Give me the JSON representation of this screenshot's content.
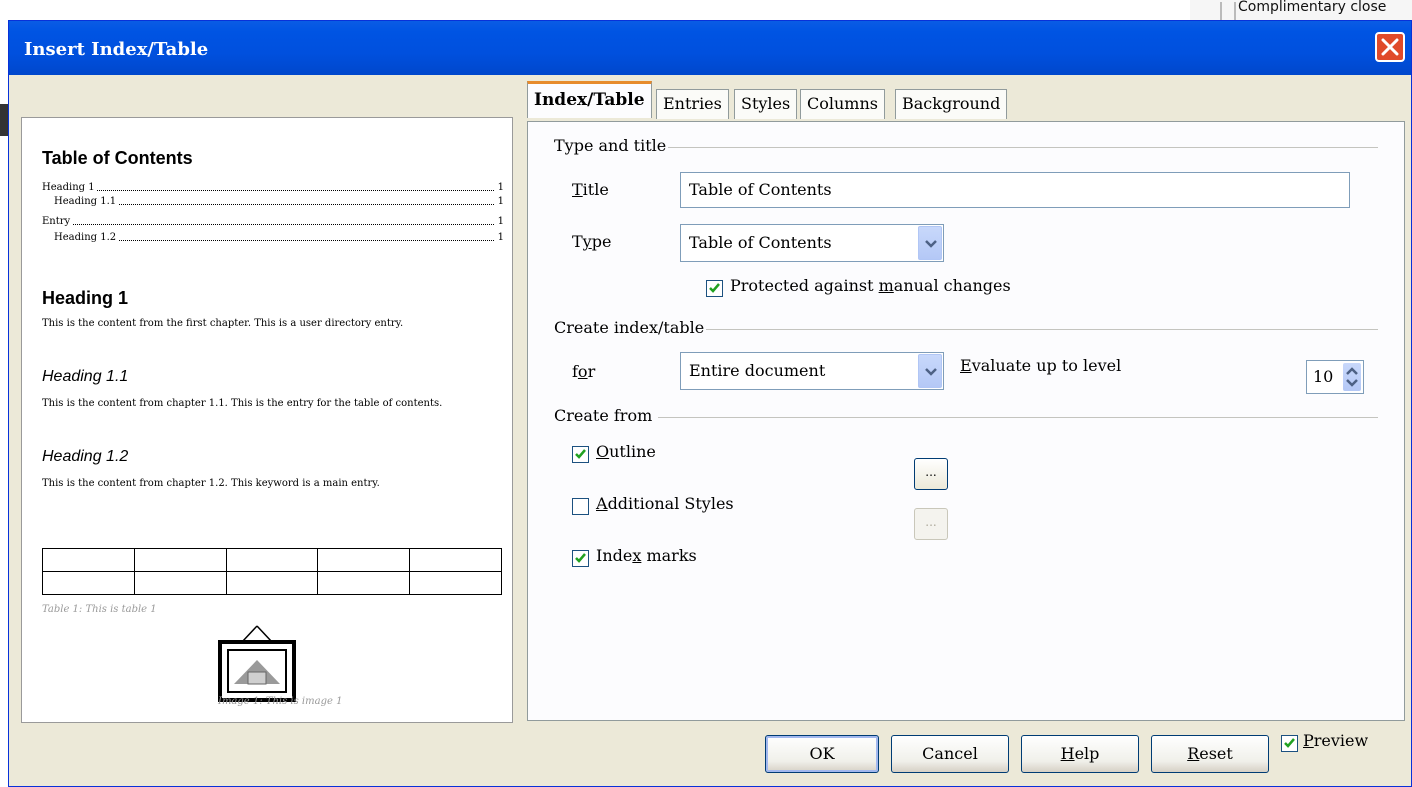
{
  "background": {
    "behind_text": "Complimentary close"
  },
  "dialog": {
    "title": "Insert Index/Table"
  },
  "preview": {
    "toc_title": "Table of Contents",
    "toc_entries": [
      {
        "label": "Heading 1",
        "page": "1"
      },
      {
        "label": "Heading 1.1",
        "page": "1"
      },
      {
        "label": "Entry",
        "page": "1"
      },
      {
        "label": "Heading 1.2",
        "page": "1"
      }
    ],
    "heading1": "Heading 1",
    "heading1_text": "This is the content from the first chapter. This is a user directory entry.",
    "heading11": "Heading 1.1",
    "heading11_text": "This is the content from chapter 1.1. This is the entry for the table of contents.",
    "heading12": "Heading 1.2",
    "heading12_text": "This is the content from chapter 1.2. This keyword is a main entry.",
    "table_caption": "Table 1: This is table 1",
    "image_caption": "Image 1: This is image 1"
  },
  "tabs": [
    {
      "label": "Index/Table",
      "active": true
    },
    {
      "label": "Entries",
      "active": false
    },
    {
      "label": "Styles",
      "active": false
    },
    {
      "label": "Columns",
      "active": false
    },
    {
      "label": "Background",
      "active": false
    }
  ],
  "type_and_title": {
    "group_label": "Type and title",
    "title_label_u": "T",
    "title_label_rest": "itle",
    "title_value": "Table of Contents",
    "type_label_pre": "T",
    "type_label_u": "y",
    "type_label_post": "pe",
    "type_value": "Table of Contents",
    "protected_pre": "Protected against ",
    "protected_u": "m",
    "protected_post": "anual changes",
    "protected_checked": true
  },
  "create_index": {
    "group_label": "Create index/table",
    "for_label_pre": "f",
    "for_label_u": "o",
    "for_label_post": "r",
    "for_value": "Entire document",
    "evaluate_u": "E",
    "evaluate_rest": "valuate up to level",
    "level_value": "10"
  },
  "create_from": {
    "group_label": "Create from",
    "outline_u": "O",
    "outline_rest": "utline",
    "outline_checked": true,
    "additional_u": "A",
    "additional_rest": "dditional Styles",
    "additional_checked": false,
    "indexmarks_pre": "Inde",
    "indexmarks_u": "x",
    "indexmarks_post": " marks",
    "indexmarks_checked": true,
    "browse_label": "..."
  },
  "footer": {
    "ok": "OK",
    "cancel": "Cancel",
    "help_u": "H",
    "help_rest": "elp",
    "reset_u": "R",
    "reset_rest": "eset",
    "preview_u": "P",
    "preview_rest": "review",
    "preview_checked": true
  },
  "colors": {
    "titlebar": "#0054e3",
    "dialog_bg": "#ece9d8",
    "tab_accent": "#e68b2c",
    "check_green": "#21a121",
    "close_red": "#e04a2a"
  }
}
